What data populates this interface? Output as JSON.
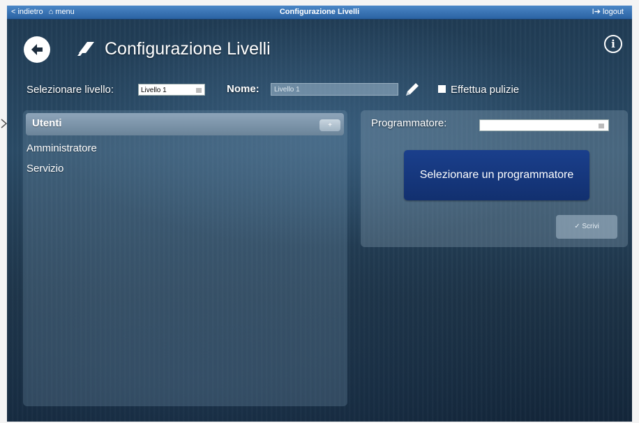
{
  "topbar": {
    "back": "< indietro",
    "menu": "menu",
    "title": "Configurazione Livelli",
    "logout": "logout"
  },
  "header": {
    "title": "Configurazione Livelli"
  },
  "form": {
    "level_label": "Selezionare livello:",
    "level_value": "Livello 1",
    "name_label": "Nome:",
    "name_value": "Livello 1",
    "cleaning_label": "Effettua pulizie"
  },
  "users_panel": {
    "title": "Utenti",
    "add_label": "+",
    "items": [
      "Amministratore",
      "Servizio"
    ]
  },
  "programmer_panel": {
    "label": "Programmatore:",
    "select_value": "",
    "select_button": "Selezionare un programmatore",
    "write_button": "✓  Scrivi"
  },
  "icons": {
    "back": "arrow-left-circle-icon",
    "title": "tag-icon",
    "info": "info-icon",
    "edit": "pencil-icon",
    "home": "home-icon",
    "logout": "logout-icon"
  },
  "colors": {
    "topbar": "#3a75b8",
    "primary_button": "#173a82",
    "background": "#1f3a52"
  }
}
